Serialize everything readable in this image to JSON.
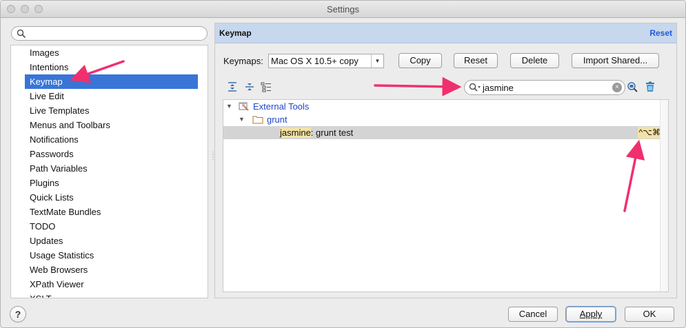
{
  "window": {
    "title": "Settings"
  },
  "left": {
    "search_placeholder": "",
    "items": [
      {
        "label": "Images"
      },
      {
        "label": "Intentions"
      },
      {
        "label": "Keymap",
        "selected": true
      },
      {
        "label": "Live Edit"
      },
      {
        "label": "Live Templates"
      },
      {
        "label": "Menus and Toolbars"
      },
      {
        "label": "Notifications"
      },
      {
        "label": "Passwords"
      },
      {
        "label": "Path Variables"
      },
      {
        "label": "Plugins"
      },
      {
        "label": "Quick Lists"
      },
      {
        "label": "TextMate Bundles"
      },
      {
        "label": "TODO"
      },
      {
        "label": "Updates"
      },
      {
        "label": "Usage Statistics"
      },
      {
        "label": "Web Browsers"
      },
      {
        "label": "XPath Viewer"
      },
      {
        "label": "XSLT"
      }
    ]
  },
  "panel": {
    "title": "Keymap",
    "reset_link": "Reset",
    "keymaps_label": "Keymaps:",
    "keymap_selected": "Mac OS X 10.5+ copy",
    "buttons": {
      "copy": "Copy",
      "reset": "Reset",
      "delete": "Delete",
      "import_shared": "Import Shared..."
    },
    "filter_value": "jasmine",
    "tree": {
      "group": "External Tools",
      "subgroup": "grunt",
      "action_match": "jasmine",
      "action_rest": ": grunt test",
      "shortcut": "^⌥⌘J"
    }
  },
  "footer": {
    "help": "?",
    "cancel": "Cancel",
    "apply": "Apply",
    "ok": "OK"
  },
  "colors": {
    "selection": "#3875d7",
    "header": "#c6d7ee",
    "link": "#1d5bd7",
    "annotation_arrow": "#f0306e",
    "match_highlight": "#f2e2a6"
  }
}
